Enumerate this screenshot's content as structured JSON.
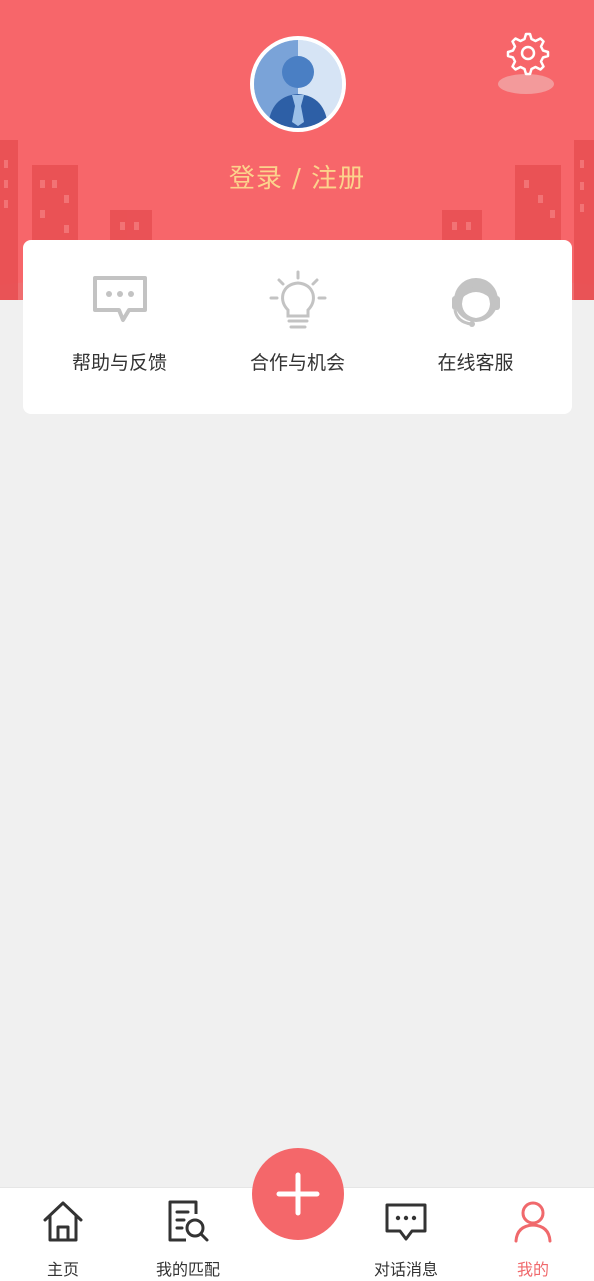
{
  "header": {
    "login_label": "登录 / 注册",
    "bg_color": "#f7666a",
    "login_color": "#fcd38c"
  },
  "services": [
    {
      "label": "帮助与反馈",
      "icon": "chat-bubble-icon"
    },
    {
      "label": "合作与机会",
      "icon": "lightbulb-icon"
    },
    {
      "label": "在线客服",
      "icon": "headset-icon"
    }
  ],
  "tabbar": {
    "items": [
      {
        "label": "主页",
        "icon": "home-icon"
      },
      {
        "label": "我的匹配",
        "icon": "document-search-icon"
      },
      {
        "label": "对话消息",
        "icon": "message-icon"
      },
      {
        "label": "我的",
        "icon": "user-icon",
        "active": true
      }
    ],
    "fab_icon": "plus-icon",
    "active_color": "#f0696c"
  }
}
